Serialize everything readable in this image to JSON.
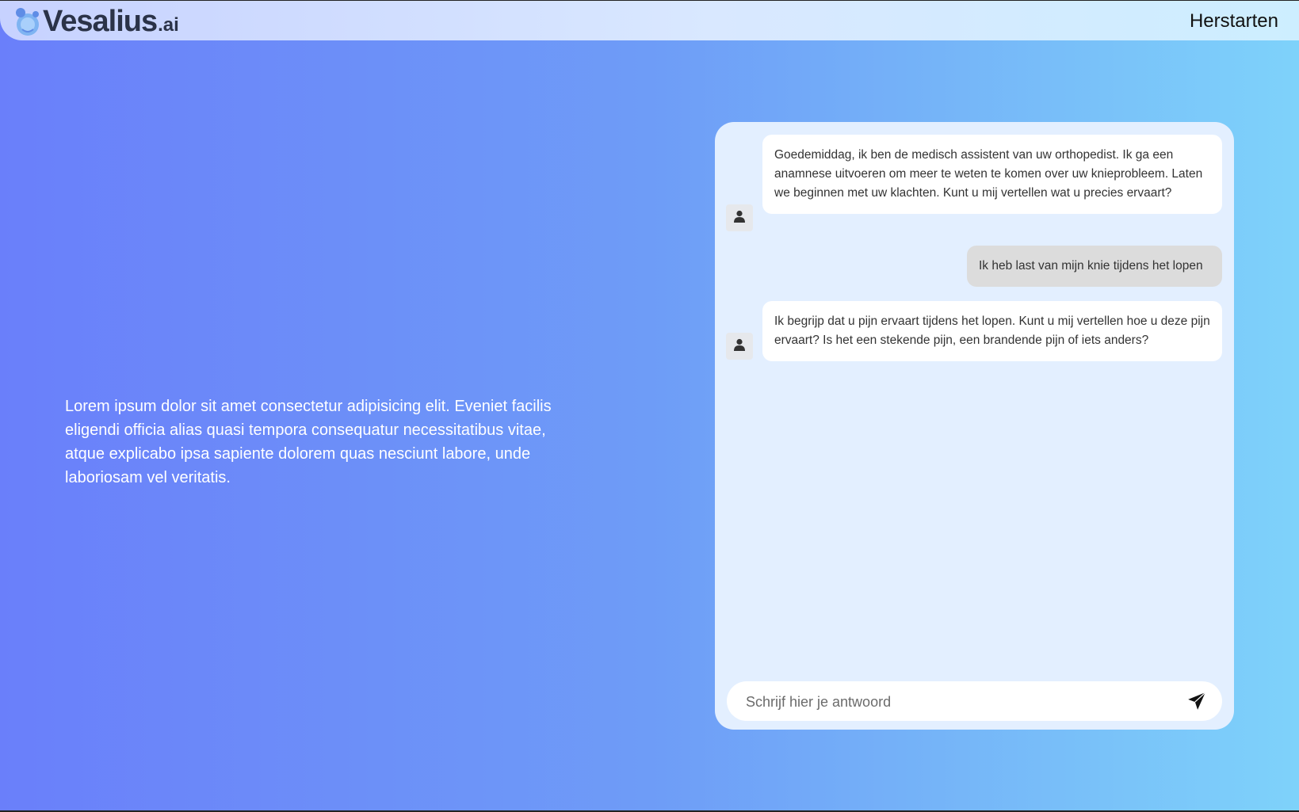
{
  "header": {
    "logo_text": "Vesalius",
    "logo_suffix": ".ai",
    "restart_label": "Herstarten"
  },
  "intro": {
    "text": "Lorem ipsum dolor sit amet consectetur adipisicing elit. Eveniet facilis eligendi officia alias quasi tempora consequatur necessitatibus vitae, atque explicabo ipsa sapiente dolorem quas nesciunt labore, unde laboriosam vel veritatis."
  },
  "chat": {
    "messages": [
      {
        "sender": "assistant",
        "text": "Goedemiddag, ik ben de medisch assistent van uw orthopedist. Ik ga een anamnese uitvoeren om meer te weten te komen over uw knieprobleem. Laten we beginnen met uw klachten. Kunt u mij vertellen wat u precies ervaart?"
      },
      {
        "sender": "user",
        "text": "Ik heb last van mijn knie tijdens het lopen"
      },
      {
        "sender": "assistant",
        "text": "Ik begrijp dat u pijn ervaart tijdens het lopen. Kunt u mij vertellen hoe u deze pijn ervaart? Is het een stekende pijn, een brandende pijn of iets anders?"
      }
    ],
    "input": {
      "placeholder": "Schrijf hier je antwoord",
      "value": ""
    },
    "icons": {
      "avatar": "user-icon",
      "send": "paper-plane-icon"
    }
  },
  "colors": {
    "background_start": "#6a7ffa",
    "background_end": "#7ed2fa",
    "panel": "#e3efff",
    "bot_bubble": "#ffffff",
    "user_bubble": "#dcdcdc"
  }
}
